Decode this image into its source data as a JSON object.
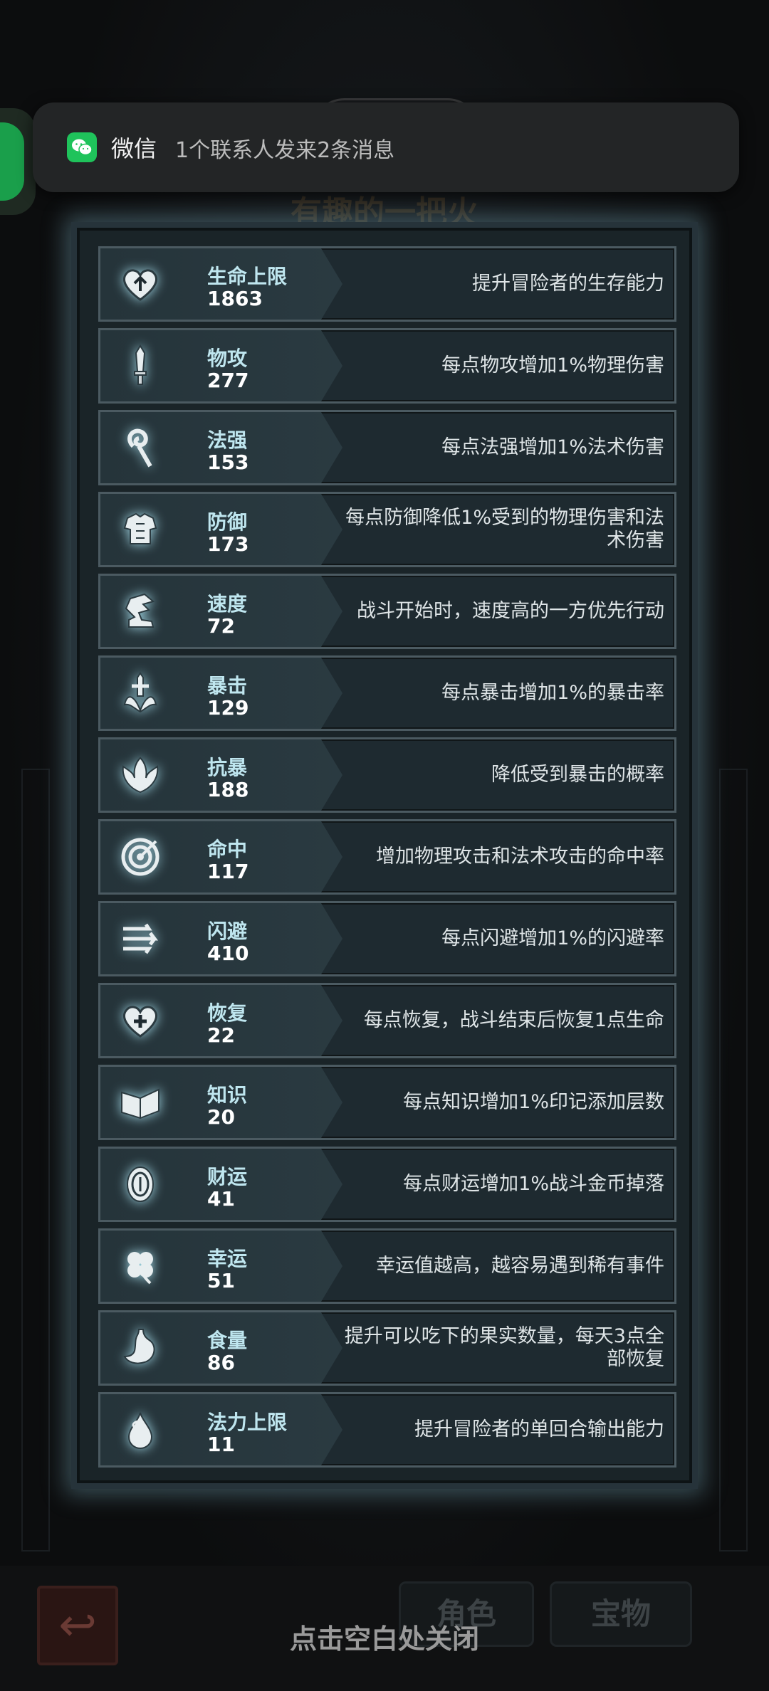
{
  "background": {
    "title": "有趣的一把火",
    "tab_role": "角色",
    "tab_treasure": "宝物"
  },
  "notification": {
    "app": "微信",
    "message": "1个联系人发来2条消息",
    "icon": "wechat-icon"
  },
  "stats": [
    {
      "name": "生命上限",
      "value": "1863",
      "desc": "提升冒险者的生存能力",
      "icon": "heart-up-icon"
    },
    {
      "name": "物攻",
      "value": "277",
      "desc": "每点物攻增加1%物理伤害",
      "icon": "sword-icon"
    },
    {
      "name": "法强",
      "value": "153",
      "desc": "每点法强增加1%法术伤害",
      "icon": "staff-icon"
    },
    {
      "name": "防御",
      "value": "173",
      "desc": "每点防御降低1%受到的物理伤害和法术伤害",
      "icon": "armor-icon"
    },
    {
      "name": "速度",
      "value": "72",
      "desc": "战斗开始时，速度高的一方优先行动",
      "icon": "winged-boot-icon"
    },
    {
      "name": "暴击",
      "value": "129",
      "desc": "每点暴击增加1%的暴击率",
      "icon": "crit-sword-icon"
    },
    {
      "name": "抗暴",
      "value": "188",
      "desc": "降低受到暴击的概率",
      "icon": "shell-shield-icon"
    },
    {
      "name": "命中",
      "value": "117",
      "desc": "增加物理攻击和法术攻击的命中率",
      "icon": "target-icon"
    },
    {
      "name": "闪避",
      "value": "410",
      "desc": "每点闪避增加1%的闪避率",
      "icon": "dodge-arrows-icon"
    },
    {
      "name": "恢复",
      "value": "22",
      "desc": "每点恢复，战斗结束后恢复1点生命",
      "icon": "heart-plus-icon"
    },
    {
      "name": "知识",
      "value": "20",
      "desc": "每点知识增加1%印记添加层数",
      "icon": "book-icon"
    },
    {
      "name": "财运",
      "value": "41",
      "desc": "每点财运增加1%战斗金币掉落",
      "icon": "coin-icon"
    },
    {
      "name": "幸运",
      "value": "51",
      "desc": "幸运值越高，越容易遇到稀有事件",
      "icon": "clover-icon"
    },
    {
      "name": "食量",
      "value": "86",
      "desc": "提升可以吃下的果实数量，每天3点全部恢复",
      "icon": "stomach-icon"
    },
    {
      "name": "法力上限",
      "value": "11",
      "desc": "提升冒险者的单回合输出能力",
      "icon": "mana-drop-icon"
    }
  ],
  "close_hint": "点击空白处关闭"
}
